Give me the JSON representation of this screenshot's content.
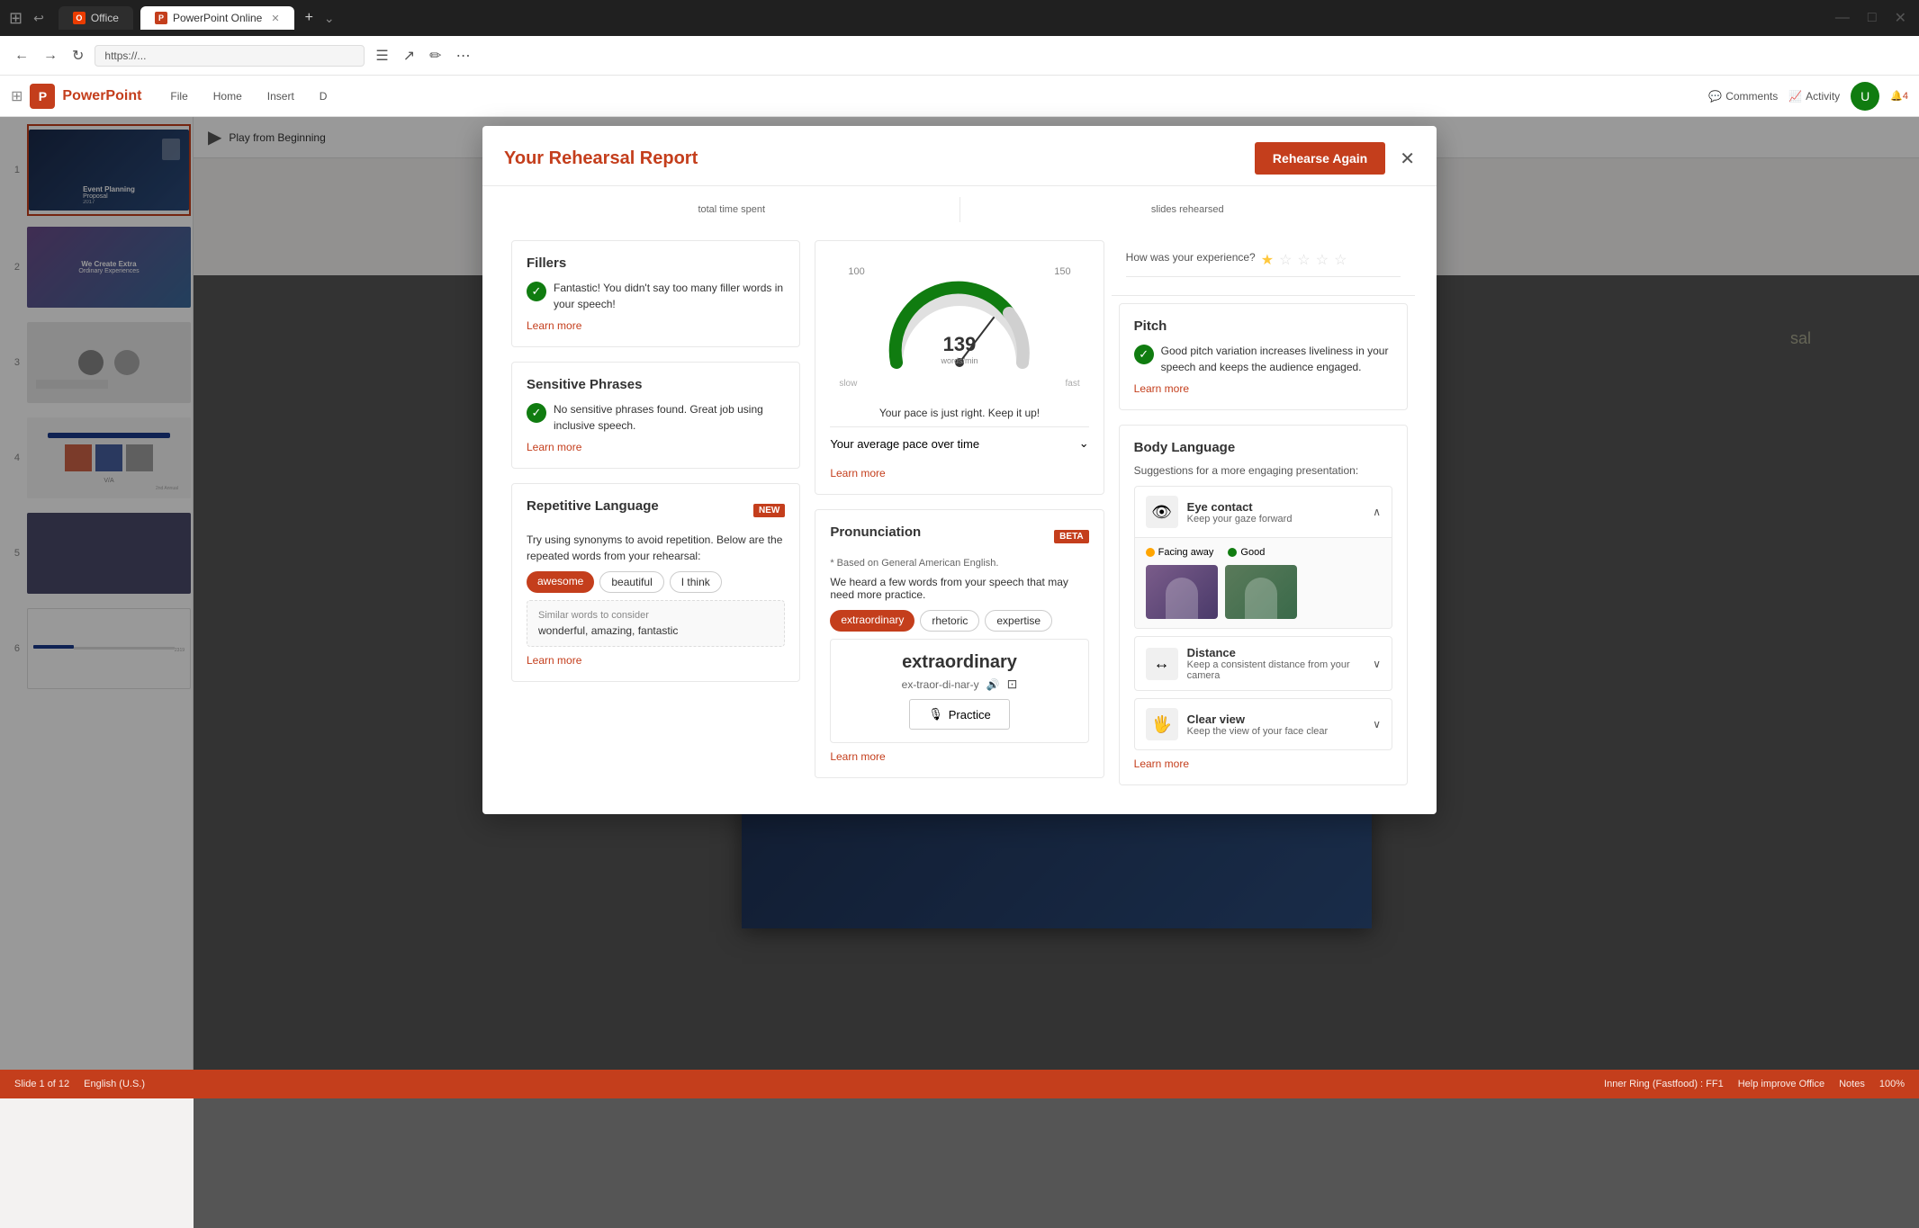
{
  "browser": {
    "tabs": [
      {
        "label": "Office",
        "active": false,
        "icon": "O"
      },
      {
        "label": "PowerPoint Online",
        "active": true,
        "icon": "P"
      }
    ],
    "url": "https://..."
  },
  "appBar": {
    "appName": "PowerPoint",
    "officeName": "Office",
    "ribbonTabs": [
      "File",
      "Home",
      "Insert",
      "D"
    ],
    "commentsLabel": "Comments",
    "activityLabel": "Activity",
    "playFromBeginning": "Play from Beginning"
  },
  "modal": {
    "title": "Your Rehearsal Report",
    "closeLabel": "×",
    "rehearseAgainLabel": "Rehearse Again",
    "stats": {
      "totalTimeLabel": "total time spent",
      "slidesRehearsedLabel": "slides rehearsed"
    },
    "fillers": {
      "title": "Fillers",
      "successText": "Fantastic! You didn't say too many filler words in your speech!",
      "learnMore": "Learn more"
    },
    "sensitivePhrases": {
      "title": "Sensitive Phrases",
      "successText": "No sensitive phrases found. Great job using inclusive speech.",
      "learnMore": "Learn more"
    },
    "repetitiveLanguage": {
      "title": "Repetitive Language",
      "badge": "NEW",
      "description": "Try using synonyms to avoid repetition. Below are the repeated words from your rehearsal:",
      "words": [
        "awesome",
        "beautiful",
        "I think"
      ],
      "similarLabel": "Similar words to consider",
      "similarWords": "wonderful, amazing, fantastic",
      "learnMore": "Learn more"
    },
    "pace": {
      "speed": 139,
      "unit": "words/min",
      "speedMin": 100,
      "speedMax": 150,
      "slowLabel": "slow",
      "fastLabel": "fast",
      "result": "Your pace is just right. Keep it up!",
      "overTimeLabel": "Your average pace over time",
      "learnMore": "Learn more"
    },
    "pronunciation": {
      "title": "Pronunciation",
      "badge": "BETA",
      "note": "* Based on General American English.",
      "heardText": "We heard a few words from your speech that may need more practice.",
      "words": [
        "extraordinary",
        "rhetoric",
        "expertise"
      ],
      "wordDetail": {
        "word": "extraordinary",
        "phonetic": "ex-traor-di-nar-y"
      },
      "practiceLabel": "Practice",
      "learnMore": "Learn more"
    },
    "experience": {
      "question": "How was your experience?",
      "stars": [
        1,
        0,
        0,
        0,
        0
      ]
    },
    "pitch": {
      "title": "Pitch",
      "successText": "Good pitch variation increases liveliness in your speech and keeps the audience engaged.",
      "learnMore": "Learn more"
    },
    "bodyLanguage": {
      "title": "Body Language",
      "description": "Suggestions for a more engaging presentation:",
      "eyeContact": {
        "title": "Eye contact",
        "description": "Keep your gaze forward",
        "facingAway": "Facing away",
        "good": "Good",
        "expanded": true
      },
      "distance": {
        "title": "Distance",
        "description": "Keep a consistent distance from your camera",
        "expanded": false
      },
      "clearView": {
        "title": "Clear view",
        "description": "Keep the view of your face clear",
        "expanded": false
      },
      "learnMore": "Learn more"
    }
  },
  "slides": [
    {
      "number": "1",
      "label": "Event Planning Proposal"
    },
    {
      "number": "2",
      "label": "We Create Extra Ordinary Experiences"
    },
    {
      "number": "3",
      "label": ""
    },
    {
      "number": "4",
      "label": ""
    },
    {
      "number": "5",
      "label": ""
    },
    {
      "number": "6",
      "label": ""
    }
  ],
  "statusBar": {
    "slideInfo": "Slide 1 of 12",
    "language": "English (U.S.)",
    "innerRing": "Inner Ring (Fastfood) : FF1",
    "helpImprove": "Help improve Office",
    "notes": "Notes",
    "zoom": "100%"
  }
}
